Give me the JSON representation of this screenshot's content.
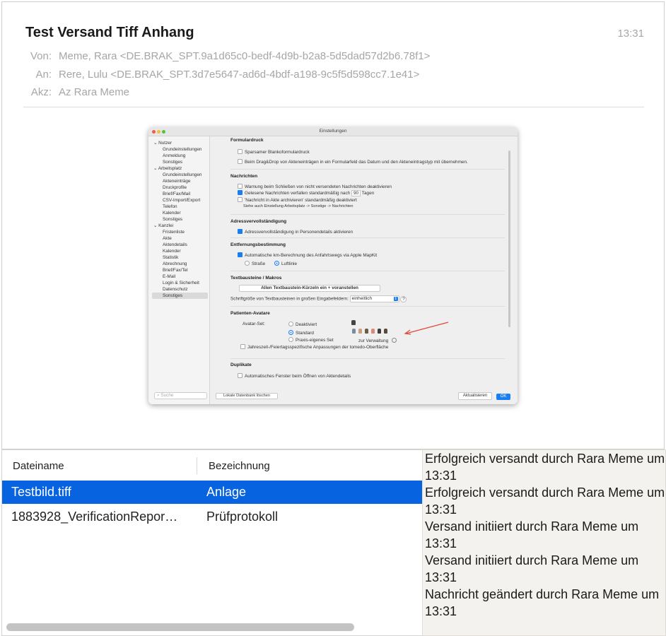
{
  "mail": {
    "subject": "Test Versand Tiff Anhang",
    "time": "13:31",
    "from_label": "Von:",
    "from": "Meme, Rara <DE.BRAK_SPT.9a1d65c0-bedf-4d9b-b2a8-5d5dad57d2b6.78f1>",
    "to_label": "An:",
    "to": "Rere, Lulu <DE.BRAK_SPT.3d7e5647-ad6d-4bdf-a198-9c5f5d598cc7.1e41>",
    "ref_label": "Akz:",
    "ref": "Az Rara Meme"
  },
  "screenshot": {
    "title": "Einstellungen",
    "sidebar": [
      {
        "label": "Nutzer",
        "kind": "group"
      },
      {
        "label": "Grundeinstellungen",
        "kind": "sub"
      },
      {
        "label": "Anmeldung",
        "kind": "sub"
      },
      {
        "label": "Sonstiges",
        "kind": "sub"
      },
      {
        "label": "Arbeitsplatz",
        "kind": "group"
      },
      {
        "label": "Grundeinstellungen",
        "kind": "sub"
      },
      {
        "label": "Akteneinträge",
        "kind": "sub"
      },
      {
        "label": "Druckprofile",
        "kind": "sub"
      },
      {
        "label": "Brief/Fax/Mail",
        "kind": "sub"
      },
      {
        "label": "CSV-Import/Export",
        "kind": "sub"
      },
      {
        "label": "Telefon",
        "kind": "sub"
      },
      {
        "label": "Kalender",
        "kind": "sub"
      },
      {
        "label": "Sonstiges",
        "kind": "sub"
      },
      {
        "label": "Kanzlei",
        "kind": "group"
      },
      {
        "label": "Fristenliste",
        "kind": "sub"
      },
      {
        "label": "Akte",
        "kind": "sub"
      },
      {
        "label": "Aktendetails",
        "kind": "sub"
      },
      {
        "label": "Kalender",
        "kind": "sub"
      },
      {
        "label": "Statistik",
        "kind": "sub"
      },
      {
        "label": "Abrechnung",
        "kind": "sub"
      },
      {
        "label": "Brief/Fax/Tel",
        "kind": "sub"
      },
      {
        "label": "E-Mail",
        "kind": "sub"
      },
      {
        "label": "Login & Sicherheit",
        "kind": "sub"
      },
      {
        "label": "Datenschutz",
        "kind": "sub"
      },
      {
        "label": "Sonstiges",
        "kind": "sub",
        "selected": true
      }
    ],
    "search_placeholder": "Suche",
    "sections": {
      "formulardruck": "Formulardruck",
      "f1": "Sparsamer Blankoformulardruck",
      "f2": "Beim Drag&Drop von Akteneinträgen in ein Formularfeld das Datum und den Akteneintragstyp mit übernehmen.",
      "nachrichten": "Nachrichten",
      "n1": "Warnung beim Schließen von nicht versendeten Nachrichten deaktivieren",
      "n2a": "Gelesene Nachrichten verfallen standardmäßig nach",
      "n2_days": "90",
      "n2b": "Tagen",
      "n3": "'Nachricht in Akte archivieren' standardmäßig deaktiviert",
      "n4": "Siehe auch Einstellung Arbeitsplatz -> Sonstige -> Nachrichten",
      "adress": "Adressvervollständigung",
      "a1": "Adressvervollständigung in Personendetails aktivieren",
      "entf": "Entfernungsbestimmung",
      "e1": "Automatische km-Berechnung des Anfahrtswegs via Apple MapKit",
      "e_strasse": "Straße",
      "e_luft": "Luftlinie",
      "text": "Textbausteine / Makros",
      "t_btn": "Allen Textbaustein-Kürzeln ein + voranstellen",
      "t_font_label": "Schriftgröße von Textbausteinen in großen Eingabefeldern:",
      "t_font_value": "einheitlich",
      "t_help": "?",
      "pat": "Patienten-Avatare",
      "p_set": "Avatar-Set:",
      "p_deakt": "Deaktiviert",
      "p_std": "Standard",
      "p_praxis": "Praxis-eigenes Set",
      "p_verw": "zur Verwaltung",
      "p_jahres": "Jahreszeit-/Feiertagsspezifische Anpassungen der tomedo-Oberfläche",
      "dup": "Duplikate",
      "d1": "Automatisches Fenster beim Öffnen von Aktendetails"
    },
    "db_button": "Lokale Datenbank löschen",
    "update_button": "Aktualisieren",
    "ok_button": "OK"
  },
  "files": {
    "col_name": "Dateiname",
    "col_desc": "Bezeichnung",
    "rows": [
      {
        "name": "Testbild.tiff",
        "desc": "Anlage"
      },
      {
        "name": "1883928_VerificationRepor…",
        "desc": "Prüfprotokoll"
      }
    ]
  },
  "log": [
    "Erfolgreich versandt durch Rara Meme um 13:31",
    "Erfolgreich versandt durch Rara Meme um 13:31",
    "Versand initiiert durch Rara Meme um 13:31",
    "Versand initiiert durch Rara Meme um 13:31",
    "Nachricht geändert durch Rara Meme um 13:31"
  ],
  "colors": {
    "selection": "#0863e0",
    "accent": "#1a7ef2",
    "annotation_arrow": "#e0483a"
  }
}
